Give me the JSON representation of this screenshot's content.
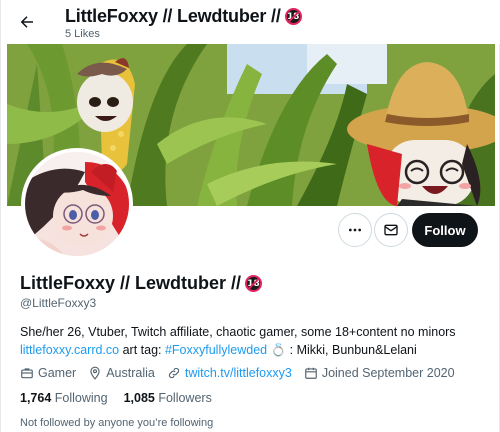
{
  "header": {
    "title": "LittleFoxxy // Lewdtuber //",
    "badge": "18",
    "subtitle": "5 Likes"
  },
  "profile": {
    "name": "LittleFoxxy // Lewdtuber //",
    "badge": "18",
    "handle": "@LittleFoxxy3",
    "bio_line1": "She/her 26, Vtuber, Twitch affiliate, chaotic gamer, some 18+content no minors",
    "bio_link": "littlefoxxy.carrd.co",
    "bio_arttag_label": " art tag: ",
    "bio_hashtag": "#Foxxyfullylewded",
    "bio_ring": " 💍",
    "bio_rest": " : Mikki, Bunbun&Lelani"
  },
  "meta": {
    "category": "Gamer",
    "location": "Australia",
    "website": "twitch.tv/littlefoxxy3",
    "joined": "Joined September 2020"
  },
  "stats": {
    "following_count": "1,764",
    "following_label": "Following",
    "followers_count": "1,085",
    "followers_label": "Followers"
  },
  "follow_context": "Not followed by anyone you’re following",
  "buttons": {
    "follow": "Follow",
    "more": "More",
    "message": "Message"
  },
  "colors": {
    "accent_link": "#1d9bf0",
    "follow_bg": "#0f1419",
    "muted_text": "#536471"
  }
}
